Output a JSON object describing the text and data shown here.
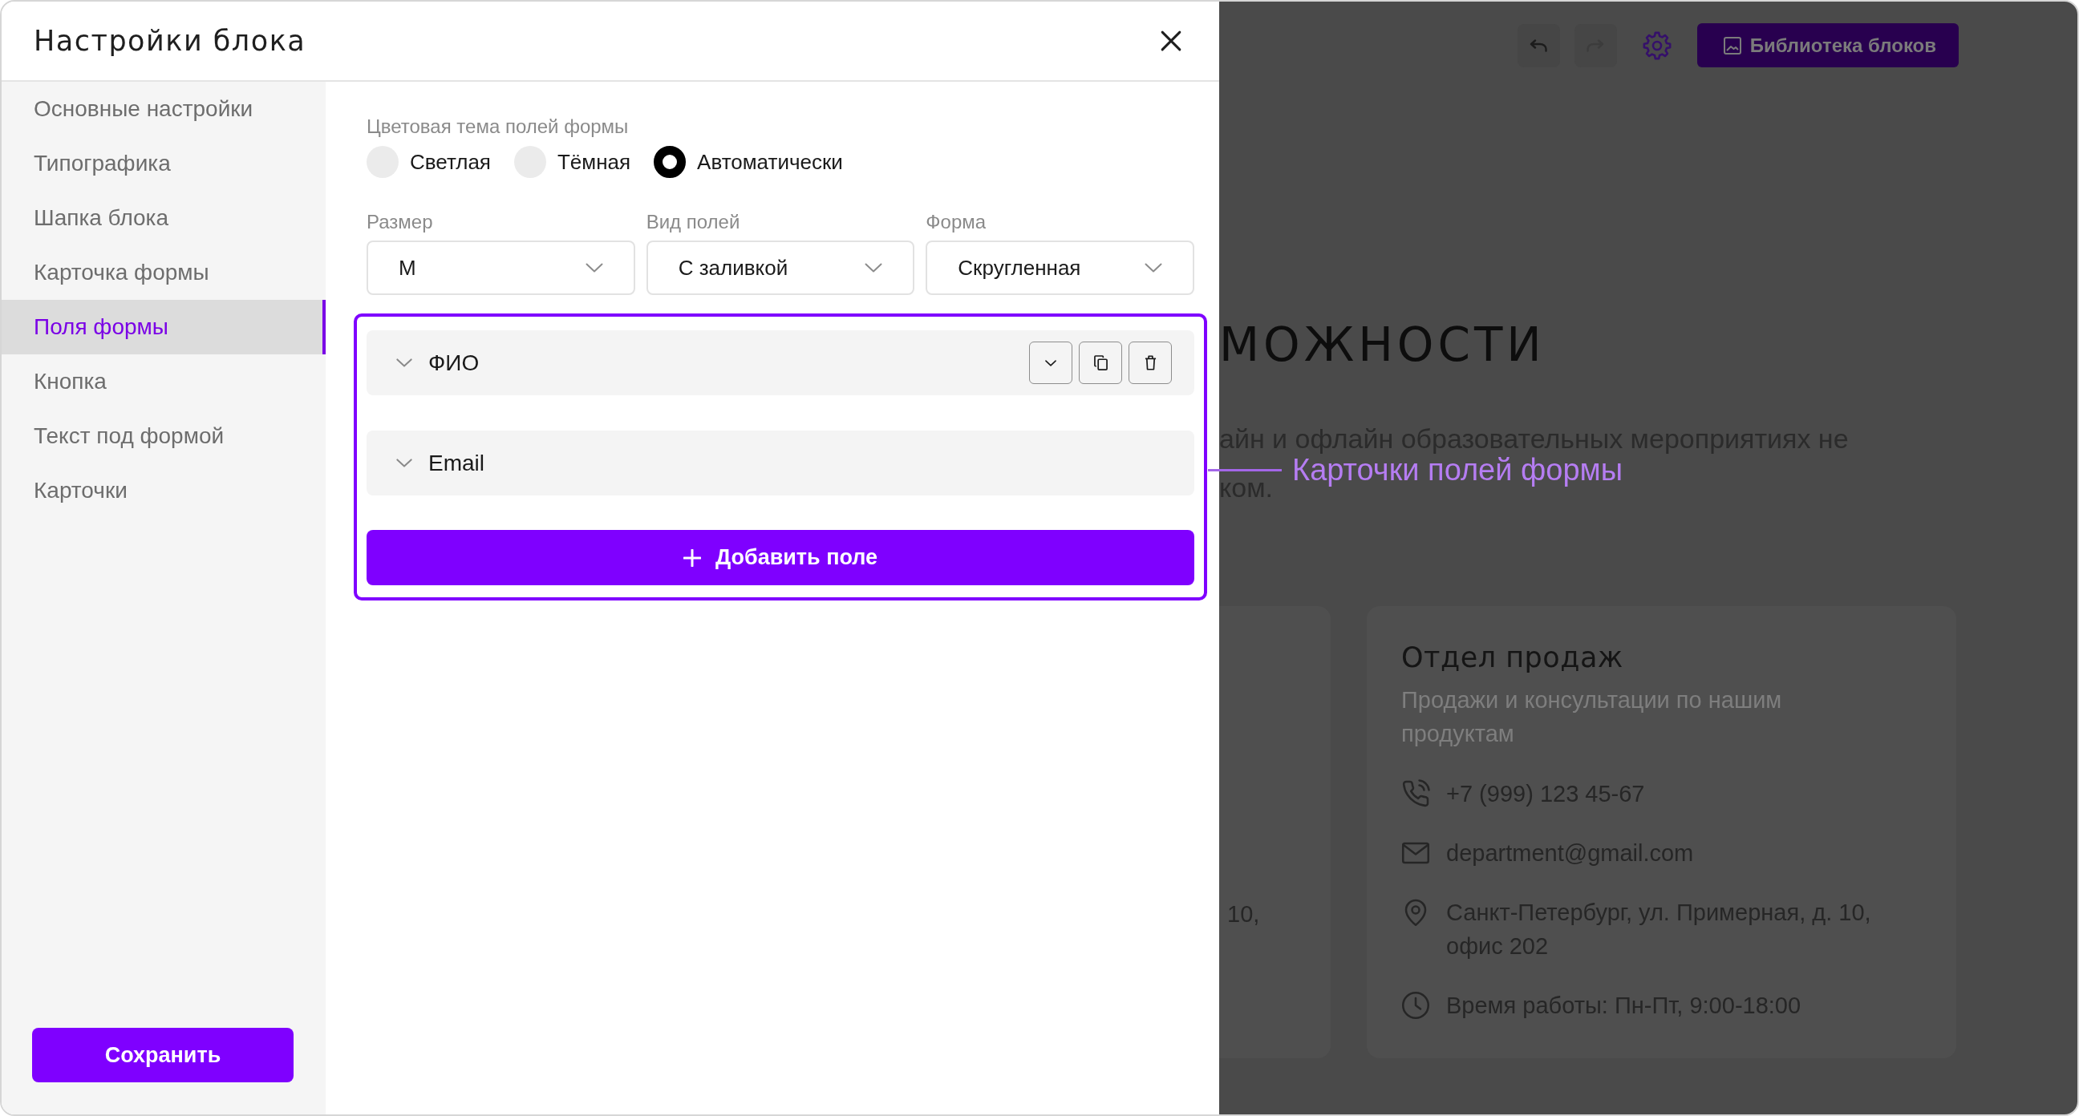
{
  "settings_panel": {
    "title": "Настройки блока"
  },
  "sidebar": {
    "items": [
      {
        "label": "Основные настройки",
        "selected": false
      },
      {
        "label": "Типографика",
        "selected": false
      },
      {
        "label": "Шапка блока",
        "selected": false
      },
      {
        "label": "Карточка формы",
        "selected": false
      },
      {
        "label": "Поля формы",
        "selected": true
      },
      {
        "label": "Кнопка",
        "selected": false
      },
      {
        "label": "Текст под формой",
        "selected": false
      },
      {
        "label": "Карточки",
        "selected": false
      }
    ],
    "save_button": "Сохранить"
  },
  "color_theme": {
    "label": "Цветовая тема полей формы",
    "options": [
      {
        "label": "Светлая",
        "selected": false
      },
      {
        "label": "Тёмная",
        "selected": false
      },
      {
        "label": "Автоматически",
        "selected": true
      }
    ]
  },
  "dropdowns": [
    {
      "label": "Размер",
      "value": "M"
    },
    {
      "label": "Вид полей",
      "value": "С заливкой"
    },
    {
      "label": "Форма",
      "value": "Скругленная"
    }
  ],
  "form_fields": {
    "highlighted": true,
    "items": [
      {
        "label": "ФИО",
        "hovered": true
      },
      {
        "label": "Email",
        "hovered": false
      }
    ],
    "add_button": "Добавить поле"
  },
  "callout": {
    "label": "Карточки полей формы"
  },
  "preview": {
    "toolbar": {
      "history_buttons": [
        {
          "kind": "undo",
          "disabled": false
        },
        {
          "kind": "redo",
          "disabled": true
        }
      ],
      "library_button": "Библиотека блоков"
    },
    "heading": "МОЖНОСТИ",
    "text_lines": [
      "айн и офлайн образовательных мероприятиях не",
      "ком."
    ],
    "cards": [
      {
        "kind": "partial",
        "text": "10,"
      },
      {
        "kind": "contact",
        "title": "Отдел продаж",
        "description": "Продажи и консультации по нашим продуктам",
        "contacts": [
          {
            "kind": "phone",
            "text": "+7 (999) 123 45-67"
          },
          {
            "kind": "email",
            "text": "department@gmail.com"
          },
          {
            "kind": "address",
            "text": "Санкт-Петербург, ул. Примерная, д. 10, офис 202"
          },
          {
            "kind": "hours",
            "text": "Время работы: Пн-Пт, 9:00-18:00"
          }
        ]
      }
    ]
  }
}
